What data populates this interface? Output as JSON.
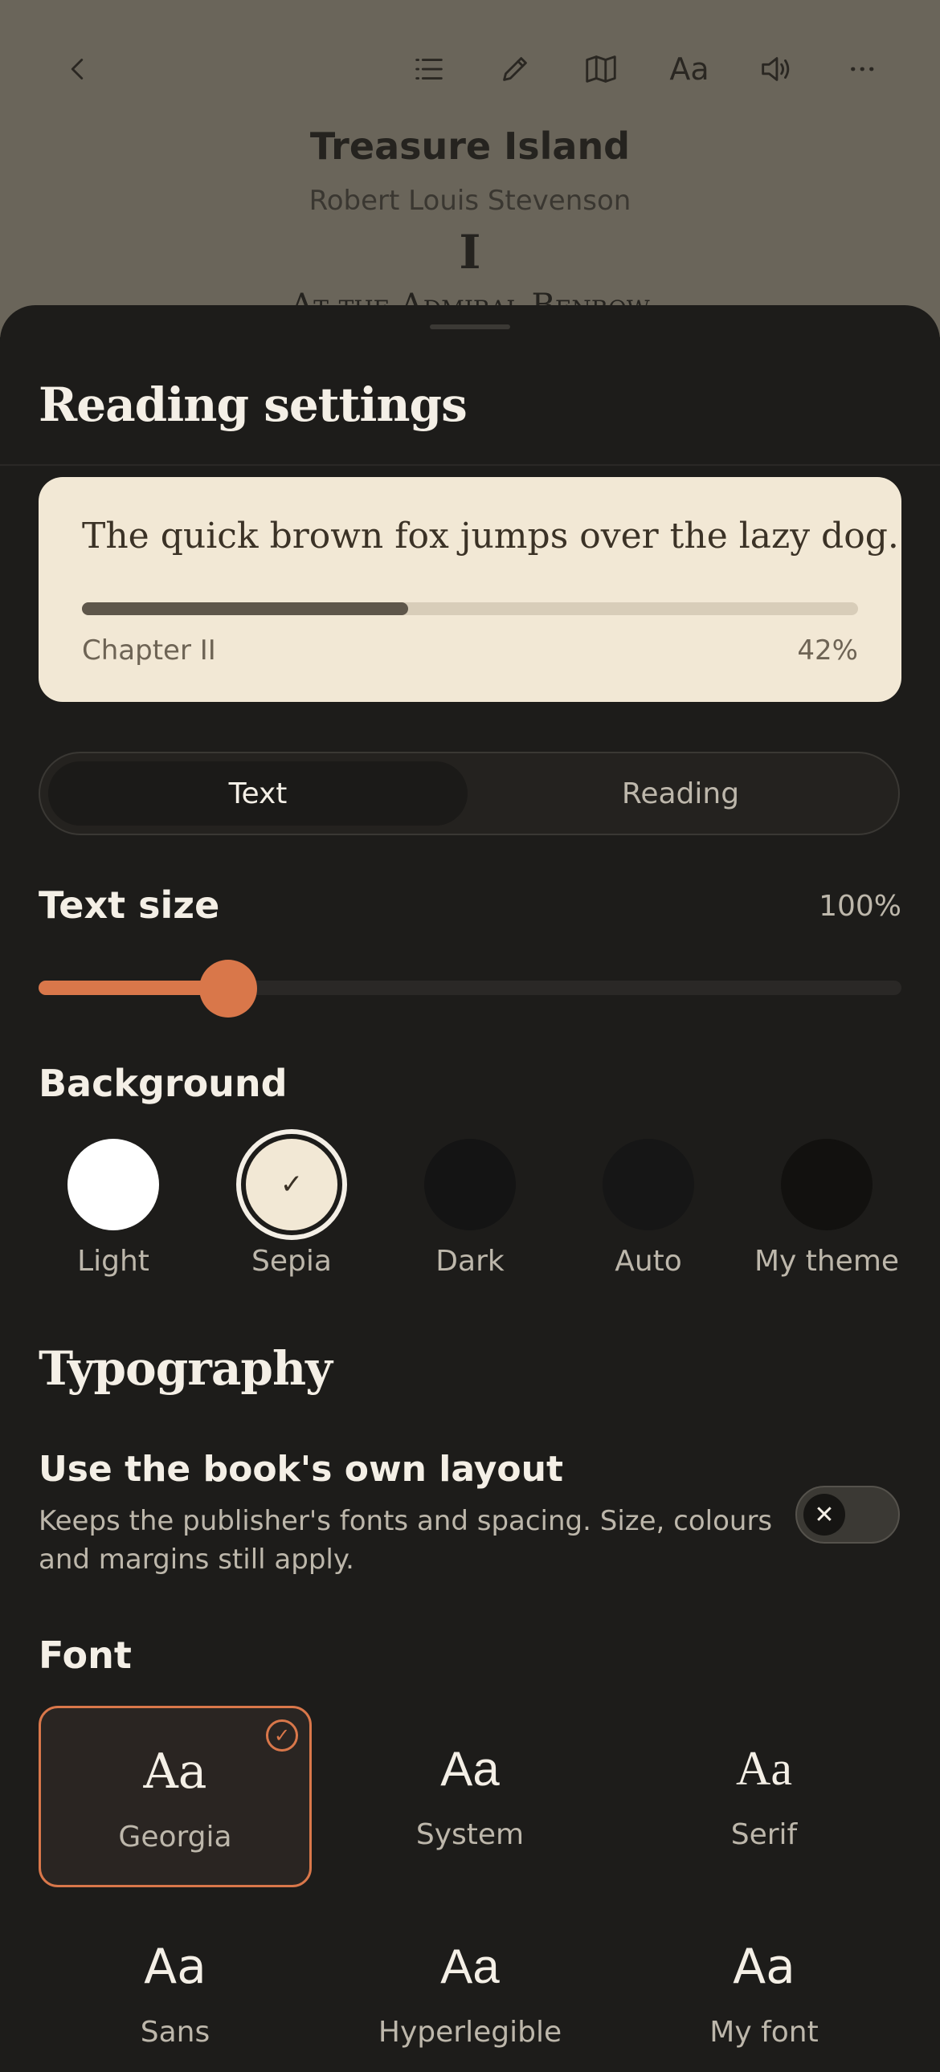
{
  "reader": {
    "book_title": "Treasure Island",
    "author": "Robert Louis Stevenson",
    "chapter_number": "I",
    "chapter_title": "At the Admiral Benbow",
    "toolbar": {
      "back_icon": "chevron-left-icon",
      "contents_icon": "list-icon",
      "annotate_icon": "pencil-icon",
      "map_icon": "map-icon",
      "text_settings_label": "Aa",
      "audio_icon": "speaker-icon",
      "more_icon": "more-icon"
    }
  },
  "sheet": {
    "title": "Reading settings",
    "preview": {
      "sample_text": "The quick brown fox jumps over the lazy dog.",
      "chapter": "Chapter II",
      "progress_label": "42%",
      "progress": 0.42
    },
    "tabs": [
      {
        "label": "Text",
        "selected": true
      },
      {
        "label": "Reading",
        "selected": false
      }
    ],
    "text_size": {
      "label": "Text size",
      "value_label": "100%",
      "slider_fraction": 0.22
    },
    "background": {
      "label": "Background",
      "options": [
        {
          "label": "Light",
          "color": "#ffffff",
          "selected": false
        },
        {
          "label": "Sepia",
          "color": "#f2e8d5",
          "selected": true
        },
        {
          "label": "Dark",
          "color": "#141414",
          "selected": false
        },
        {
          "label": "Auto",
          "color": "#161616",
          "selected": false
        },
        {
          "label": "My theme",
          "color": "#12110f",
          "selected": false
        }
      ]
    },
    "typography": {
      "title": "Typography",
      "book_layout": {
        "title": "Use the book's own layout",
        "description": "Keeps the publisher's fonts and spacing. Size, colours and margins still apply.",
        "enabled": false
      },
      "font": {
        "label": "Font",
        "sample": "Aa",
        "options": [
          {
            "name": "Georgia",
            "selected": true
          },
          {
            "name": "System",
            "selected": false
          },
          {
            "name": "Serif",
            "selected": false
          },
          {
            "name": "Sans",
            "selected": false
          },
          {
            "name": "Hyperlegible",
            "selected": false
          },
          {
            "name": "My font",
            "selected": false
          }
        ]
      }
    }
  },
  "colors": {
    "accent": "#d9774a",
    "sheet_background": "#1d1c1a",
    "preview_background": "#f2e8d5"
  }
}
